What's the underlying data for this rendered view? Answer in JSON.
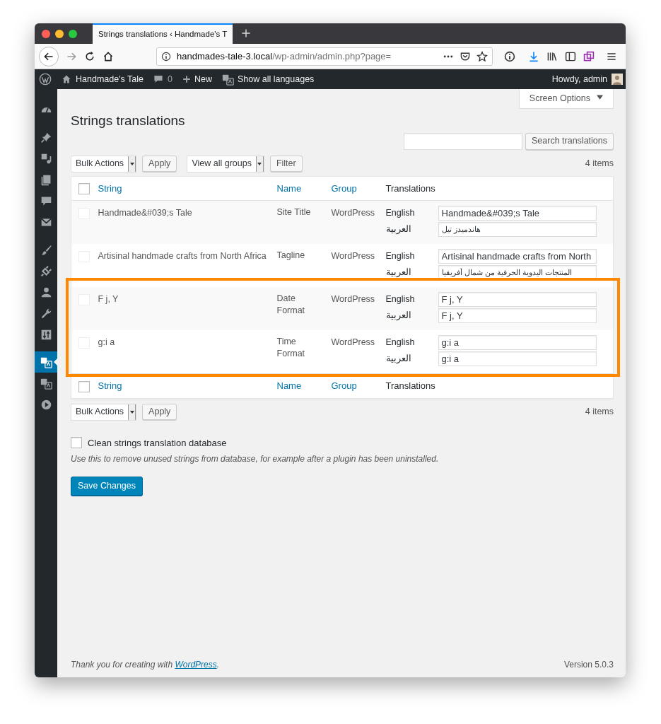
{
  "browser": {
    "tab_title": "Strings translations ‹ Handmade's T",
    "url_host": "handmades-tale-3.local",
    "url_path": "/wp-admin/admin.php?page="
  },
  "admin_bar": {
    "site_name": "Handmade's Tale",
    "comments": "0",
    "new_label": "New",
    "languages_label": "Show all languages",
    "greeting": "Howdy, admin"
  },
  "sidebar": {
    "items": [
      {
        "selected": false
      },
      {
        "selected": false
      },
      {
        "selected": false
      },
      {
        "selected": false
      },
      {
        "selected": false
      },
      {
        "selected": false
      },
      {
        "selected": false
      },
      {
        "selected": false
      },
      {
        "selected": false
      },
      {
        "selected": false
      },
      {
        "selected": false
      },
      {
        "selected": true
      },
      {
        "selected": false
      },
      {
        "selected": false
      }
    ]
  },
  "screen_options": "Screen Options",
  "page_title": "Strings translations",
  "search": {
    "button": "Search translations"
  },
  "top_nav": {
    "bulk_actions": "Bulk Actions",
    "apply": "Apply",
    "group_filter": "View all groups",
    "filter": "Filter",
    "count": "4 items"
  },
  "table": {
    "select_all_checked": false,
    "columns": [
      {
        "label": "String",
        "sortable": true
      },
      {
        "label": "Name",
        "sortable": true
      },
      {
        "label": "Group",
        "sortable": true
      },
      {
        "label": "Translations",
        "sortable": false
      }
    ],
    "rows": [
      {
        "string": "Handmade&#039;s Tale",
        "name": "Site Title",
        "group": "WordPress",
        "checked": false,
        "disabled": true,
        "highlighted": false,
        "translations": [
          {
            "language": "English",
            "value": "Handmade&#039;s Tale",
            "rtl": false
          },
          {
            "language": "العربية",
            "value": "هاندميدز تيل",
            "rtl": true
          }
        ]
      },
      {
        "string": "Artisinal handmade crafts from North Africa",
        "name": "Tagline",
        "group": "WordPress",
        "checked": false,
        "disabled": true,
        "highlighted": false,
        "translations": [
          {
            "language": "English",
            "value": "Artisinal handmade crafts from North",
            "rtl": false
          },
          {
            "language": "العربية",
            "value": "المنتجات اليدوية الحرفية من شمال أفريقيا",
            "rtl": true
          }
        ]
      },
      {
        "string": "F j, Y",
        "name": "Date Format",
        "group": "WordPress",
        "checked": false,
        "disabled": true,
        "highlighted": true,
        "translations": [
          {
            "language": "English",
            "value": "F j, Y",
            "rtl": false
          },
          {
            "language": "العربية",
            "value": "F j, Y",
            "rtl": false
          }
        ]
      },
      {
        "string": "g:i a",
        "name": "Time Format",
        "group": "WordPress",
        "checked": false,
        "disabled": true,
        "highlighted": true,
        "translations": [
          {
            "language": "English",
            "value": "g:i a",
            "rtl": false
          },
          {
            "language": "العربية",
            "value": "g:i a",
            "rtl": false
          }
        ]
      }
    ],
    "footer_columns": [
      {
        "label": "String",
        "sortable": true
      },
      {
        "label": "Name",
        "sortable": true
      },
      {
        "label": "Group",
        "sortable": true
      },
      {
        "label": "Translations",
        "sortable": false
      }
    ],
    "footer_select_all_checked": false
  },
  "bottom_nav": {
    "bulk_actions": "Bulk Actions",
    "apply": "Apply",
    "count": "4 items"
  },
  "clean_option": {
    "label": "Clean strings translation database",
    "checked": false,
    "description": "Use this to remove unused strings from database, for example after a plugin has been uninstalled."
  },
  "save_button": "Save Changes",
  "footer": {
    "text_before": "Thank you for creating with ",
    "link": "WordPress",
    "text_after": ".",
    "version": "Version 5.0.3"
  }
}
